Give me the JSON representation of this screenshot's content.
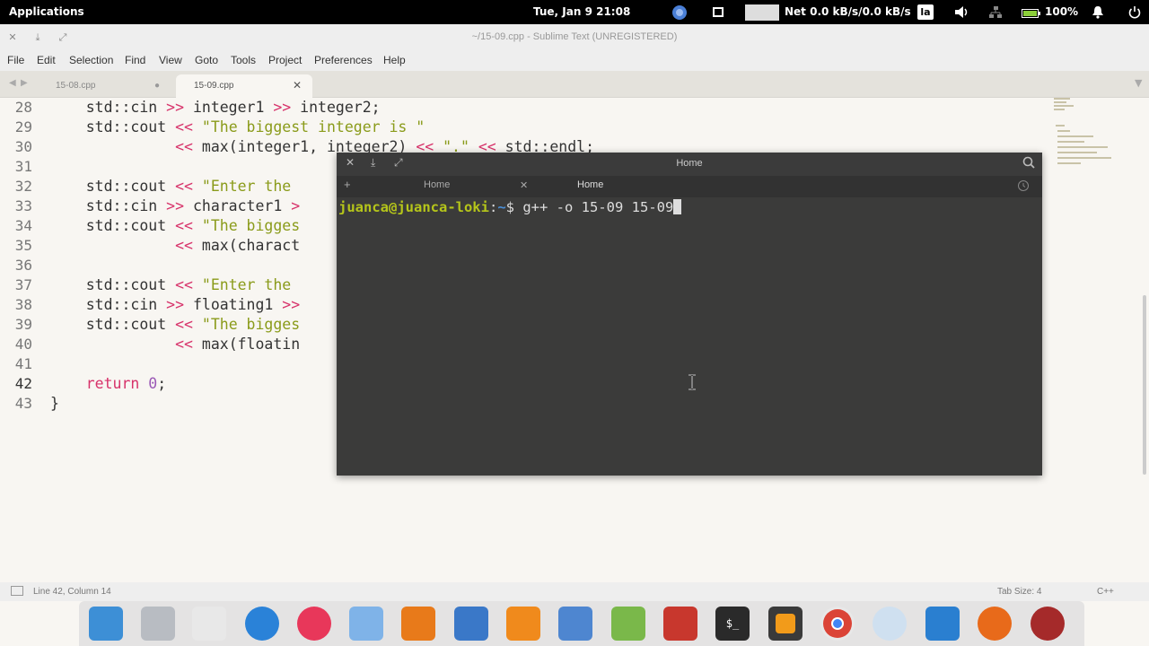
{
  "panel": {
    "applications": "Applications",
    "datetime": "Tue, Jan 9   21:08",
    "net": "Net 0.0 kB/s/0.0 kB/s",
    "keyboard": "la",
    "battery": "100%"
  },
  "sublime": {
    "title": "~/15-09.cpp - Sublime Text (UNREGISTERED)",
    "menu": [
      "File",
      "Edit",
      "Selection",
      "Find",
      "View",
      "Goto",
      "Tools",
      "Project",
      "Preferences",
      "Help"
    ],
    "tabs": [
      {
        "label": "15-08.cpp",
        "active": false
      },
      {
        "label": "15-09.cpp",
        "active": true
      }
    ],
    "status_left": "Line 42, Column 14",
    "tab_size": "Tab Size: 4",
    "syntax": "C++",
    "line_numbers": [
      "28",
      "29",
      "30",
      "31",
      "32",
      "33",
      "34",
      "35",
      "36",
      "37",
      "38",
      "39",
      "40",
      "41",
      "42",
      "43"
    ],
    "code": {
      "l28": "    std::cin >> integer1 >> integer2;",
      "l29": "    std::cout << \"The biggest integer is \"",
      "l30": "              << max(integer1, integer2) << \".\" << std::endl;",
      "l32": "    std::cout << \"Enter the ",
      "l33": "    std::cin >> character1 >",
      "l34": "    std::cout << \"The bigges",
      "l35": "              << max(charact",
      "l37": "    std::cout << \"Enter the ",
      "l38": "    std::cin >> floating1 >>",
      "l39": "    std::cout << \"The bigges",
      "l40": "              << max(floatin",
      "l42": "    return 0;",
      "l43": "}"
    }
  },
  "terminal": {
    "title": "Home",
    "tabs": [
      "Home",
      "Home"
    ],
    "user_host": "juanca@juanca-loki",
    "sep": ":",
    "dir": "~",
    "prompt": "$ ",
    "command": "g++ -o 15-09 15-09"
  },
  "colors": {
    "panel_bg": "#000000",
    "editor_bg": "#f8f6f2",
    "terminal_bg": "#2c2c2c",
    "accent_operator": "#d7326a",
    "accent_string": "#8a9b1a"
  },
  "dock_icons": [
    "workspace-switcher-icon",
    "home-folder-icon",
    "texstudio-icon",
    "qtcreator-icon",
    "flickr-icon",
    "settings-toggle-icon",
    "inkscape-icon",
    "writer-icon",
    "vlc-icon",
    "pencil-icon",
    "gedit-icon",
    "foxit-icon",
    "terminal-icon",
    "sublime-icon",
    "chrome-icon",
    "musescore-icon",
    "waveform-icon",
    "firefox-icon",
    "ruby-icon"
  ]
}
